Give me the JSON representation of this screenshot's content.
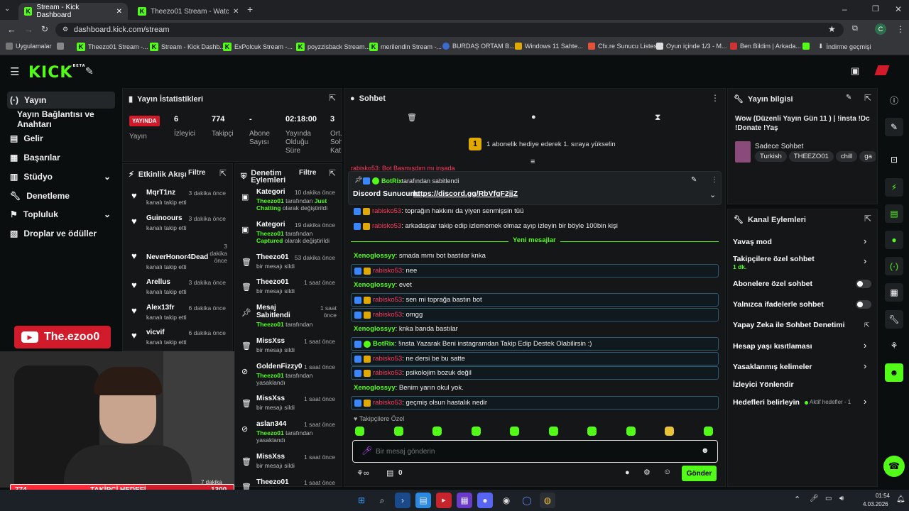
{
  "browser": {
    "tabs": [
      {
        "title": "Stream - Kick Dashboard"
      },
      {
        "title": "Theezo01 Stream - Watch Live"
      }
    ],
    "url": "dashboard.kick.com/stream",
    "profile_initial": "C",
    "bookmarks": [
      "Uygulamalar",
      "Theezo01 Stream -...",
      "Stream - Kick Dashb...",
      "ExPolcuk Stream -...",
      "poyzzisback Stream...",
      "merilendin Stream -...",
      "BURDAŞ ORTAM B...",
      "Windows 11 Sahte...",
      "Cfx.re Sunucu Listesi",
      "Oyun içinde 1/3 - M...",
      "Ben Bildim | Arkada...",
      "",
      "İndirme geçmişi"
    ]
  },
  "header": {
    "logo": "KICK",
    "logo_sup": "BETA"
  },
  "sidebar": {
    "items": [
      {
        "label": "Yayın",
        "icon": "broadcast-icon"
      },
      {
        "label": "Yayın Bağlantısı ve Anahtarı",
        "icon": ""
      },
      {
        "label": "Gelir",
        "icon": "money-icon"
      },
      {
        "label": "Başarılar",
        "icon": "trophy-icon"
      },
      {
        "label": "Stüdyo",
        "icon": "studio-icon"
      },
      {
        "label": "Denetleme",
        "icon": "wrench-icon"
      },
      {
        "label": "Topluluk",
        "icon": "community-icon"
      },
      {
        "label": "Droplar ve ödüller",
        "icon": "gift-icon"
      }
    ]
  },
  "stats": {
    "title": "Yayın İstatistikleri",
    "live_badge": "YAYINDA",
    "items": [
      {
        "value": "6",
        "label": "İzleyici"
      },
      {
        "value": "774",
        "label": "Takipçi"
      },
      {
        "value": "-",
        "label": "Abone Sayısı"
      },
      {
        "value": "02:18:00",
        "label": "Yayında Olduğu Süre"
      },
      {
        "value": "3",
        "label": "Ort. Soh Katı"
      }
    ],
    "live_label": "Yayın"
  },
  "activity": {
    "title": "Etkinlik Akışı",
    "filter": "Filtre",
    "items": [
      {
        "name": "MqrT1nz",
        "time": "3 dakika önce",
        "sub": "kanalı takip etti"
      },
      {
        "name": "Guinoours",
        "time": "3 dakika önce",
        "sub": "kanalı takip etti"
      },
      {
        "name": "NeverHonor4Dead",
        "time": "3 dakika önce",
        "sub": "kanalı takip etti"
      },
      {
        "name": "Arellus",
        "time": "3 dakika önce",
        "sub": "kanalı takip etti"
      },
      {
        "name": "Alex13fr",
        "time": "6 dakika önce",
        "sub": "kanalı takip etti"
      },
      {
        "name": "vicvif",
        "time": "6 dakika önce",
        "sub": "kanalı takip etti"
      }
    ]
  },
  "moderation": {
    "title": "Denetim Eylemleri",
    "filter": "Filtre",
    "items": [
      {
        "name": "Kategori",
        "time": "10 dakika önce",
        "actor": "Theezo01",
        "rest": " tarafından ",
        "extra": "Just Chatting",
        "tail": " olarak değiştirildi"
      },
      {
        "name": "Kategori",
        "time": "19 dakika önce",
        "actor": "Theezo01",
        "rest": " tarafından ",
        "extra": "Captured",
        "tail": " olarak değiştirildi"
      },
      {
        "name": "Theezo01",
        "time": "53 dakika önce",
        "actor": "",
        "rest": "bir mesajı sildi",
        "extra": "",
        "tail": ""
      },
      {
        "name": "Theezo01",
        "time": "1 saat önce",
        "actor": "",
        "rest": "bir mesajı sildi",
        "extra": "",
        "tail": ""
      },
      {
        "name": "Mesaj Sabitlendi",
        "time": "1 saat önce",
        "actor": "Theezo01",
        "rest": " tarafından",
        "extra": "",
        "tail": ""
      },
      {
        "name": "MissXss",
        "time": "1 saat önce",
        "actor": "",
        "rest": "bir mesajı sildi",
        "extra": "",
        "tail": ""
      },
      {
        "name": "GoldenFizzy0",
        "time": "1 saat önce",
        "actor": "Theezo01",
        "rest": " tarafından",
        "extra": "",
        "tail": "yasaklandı"
      },
      {
        "name": "MissXss",
        "time": "1 saat önce",
        "actor": "",
        "rest": "bir mesajı sildi",
        "extra": "",
        "tail": ""
      },
      {
        "name": "aslan344",
        "time": "1 saat önce",
        "actor": "Theezo01",
        "rest": " tarafından",
        "extra": "",
        "tail": "yasaklandı"
      },
      {
        "name": "MissXss",
        "time": "1 saat önce",
        "actor": "",
        "rest": "bir mesajı sildi",
        "extra": "",
        "tail": ""
      },
      {
        "name": "Theezo01",
        "time": "1 saat önce",
        "actor": "",
        "rest": "",
        "extra": "",
        "tail": ""
      }
    ]
  },
  "overlay": {
    "channel": "The.ezoo0",
    "goal_left": "774",
    "goal_label": "TAKİPÇİ HEDEFİ",
    "goal_right": "1300",
    "goal_progress": 0.595,
    "tile_time": "7 dakika"
  },
  "chat": {
    "title": "Sohbet",
    "gift_banner": "1 abonelik hediye ederek 1. sıraya yükselin",
    "gift_num": "1",
    "partial": "rabisko53: Bot Basmışdım mı inşada",
    "pinned": {
      "by": "BotRix",
      "by_rest": " tarafından sabitlendi",
      "text": "Discord Sunucum: ",
      "link": "https://discord.gg/RbVfgF2jjZ"
    },
    "messages": [
      {
        "user": "rabisko53",
        "text": ": toprağın hakkını da yiyen senmişsin tüü",
        "style": "red",
        "boxed": false
      },
      {
        "user": "rabisko53",
        "text": ": arkadaşlar takip edip izlememek olmaz ayıp izleyin bir böyle 100bin kişi",
        "style": "red",
        "boxed": false
      }
    ],
    "new_divider": "Yeni mesajlar",
    "new_messages": [
      {
        "user": "Xenoglossyy",
        "text": ": smada mmı bot bastılar knka",
        "style": "green",
        "boxed": false
      },
      {
        "user": "rabisko53",
        "text": ": nee",
        "style": "red",
        "boxed": true
      },
      {
        "user": "Xenoglossyy",
        "text": ": evet",
        "style": "green",
        "boxed": false
      },
      {
        "user": "rabisko53",
        "text": ": sen mi toprağa bastın bot",
        "style": "red",
        "boxed": true
      },
      {
        "user": "rabisko53",
        "text": ": omgg",
        "style": "red",
        "boxed": true
      },
      {
        "user": "Xenoglossyy",
        "text": ": knka banda bastılar",
        "style": "green",
        "boxed": false
      },
      {
        "user": "BotRix",
        "text": ": !insta Yazarak Beni instagramdan Takip Edip Destek Olabilirsin :)",
        "style": "bot",
        "boxed": true
      },
      {
        "user": "rabisko53",
        "text": ": ne dersi be bu satte",
        "style": "red",
        "boxed": true
      },
      {
        "user": "rabisko53",
        "text": ": psikolojim bozuk değil",
        "style": "red",
        "boxed": true
      },
      {
        "user": "Xenoglossyy",
        "text": ": Benim yarın okul yok.",
        "style": "green",
        "boxed": false
      },
      {
        "user": "rabisko53",
        "text": ": geçmiş olsun hastalık nedir",
        "style": "red",
        "boxed": true
      }
    ],
    "followers_only": "Takipçilere Özel",
    "input_placeholder": "Bir mesaj gönderin",
    "points": "0",
    "send": "Gönder"
  },
  "stream_info": {
    "title": "Yayın bilgisi",
    "stream_title": "Wow (Düzenli Yayın Gün 11 ) | !insta !Dc !Donate !Yaş",
    "category": "Sadece Sohbet",
    "tags": [
      "Turkish",
      "THEEZO01",
      "chill",
      "ga"
    ]
  },
  "channel_actions": {
    "title": "Kanal Eylemleri",
    "items": [
      {
        "label": "Yavaş mod",
        "sub": "",
        "control": "chevron"
      },
      {
        "label": "Takipçilere özel sohbet",
        "sub": "1 dk.",
        "control": "chevron"
      },
      {
        "label": "Abonelere özel sohbet",
        "sub": "",
        "control": "toggle"
      },
      {
        "label": "Yalnızca ifadelerle sohbet",
        "sub": "",
        "control": "toggle"
      },
      {
        "label": "Yapay Zeka ile Sohbet Denetimi",
        "sub": "",
        "control": "external"
      },
      {
        "label": "Hesap yaşı kısıtlaması",
        "sub": "",
        "control": "chevron"
      },
      {
        "label": "Yasaklanmış kelimeler",
        "sub": "",
        "control": "chevron"
      },
      {
        "label": "İzleyici Yönlendir",
        "sub": "",
        "control": "none"
      },
      {
        "label": "Hedefleri belirleyin",
        "sub": "",
        "control": "chevron",
        "status": "Aktif hedefler - 1"
      }
    ]
  },
  "taskbar": {
    "time": "01:54",
    "date": "4.03.2026"
  },
  "colors": {
    "brand": "#53fc18",
    "live": "#d11a2a",
    "bg": "#0b0e0f",
    "panel": "#141618"
  }
}
